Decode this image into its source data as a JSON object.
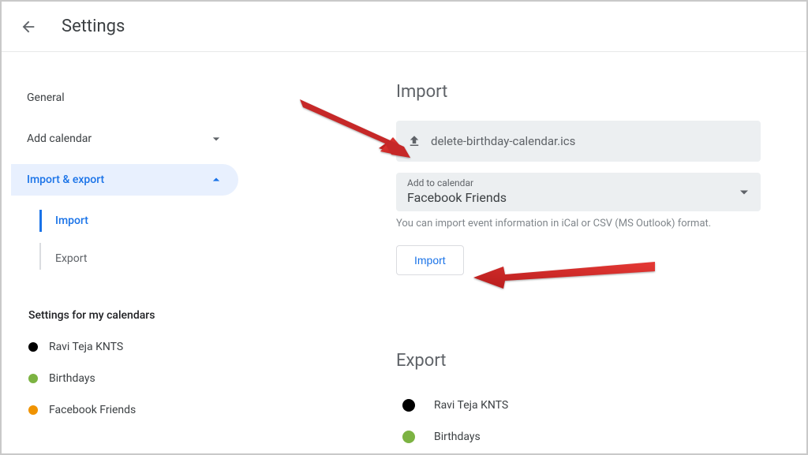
{
  "header": {
    "title": "Settings"
  },
  "sidebar": {
    "general_label": "General",
    "add_calendar_label": "Add calendar",
    "import_export_label": "Import & export",
    "import_label": "Import",
    "export_label": "Export",
    "my_calendars_label": "Settings for my calendars",
    "calendars": [
      {
        "label": "Ravi Teja KNTS",
        "color": "#000000"
      },
      {
        "label": "Birthdays",
        "color": "#7cb342"
      },
      {
        "label": "Facebook Friends",
        "color": "#f09300"
      }
    ]
  },
  "import": {
    "title": "Import",
    "file_name": "delete-birthday-calendar.ics",
    "add_to_label": "Add to calendar",
    "add_to_value": "Facebook Friends",
    "hint": "You can import event information in iCal or CSV (MS Outlook) format.",
    "button_label": "Import"
  },
  "export": {
    "title": "Export",
    "calendars": [
      {
        "label": "Ravi Teja KNTS",
        "color": "#000000"
      },
      {
        "label": "Birthdays",
        "color": "#7cb342"
      }
    ]
  },
  "colors": {
    "accent": "#1a73e8"
  }
}
